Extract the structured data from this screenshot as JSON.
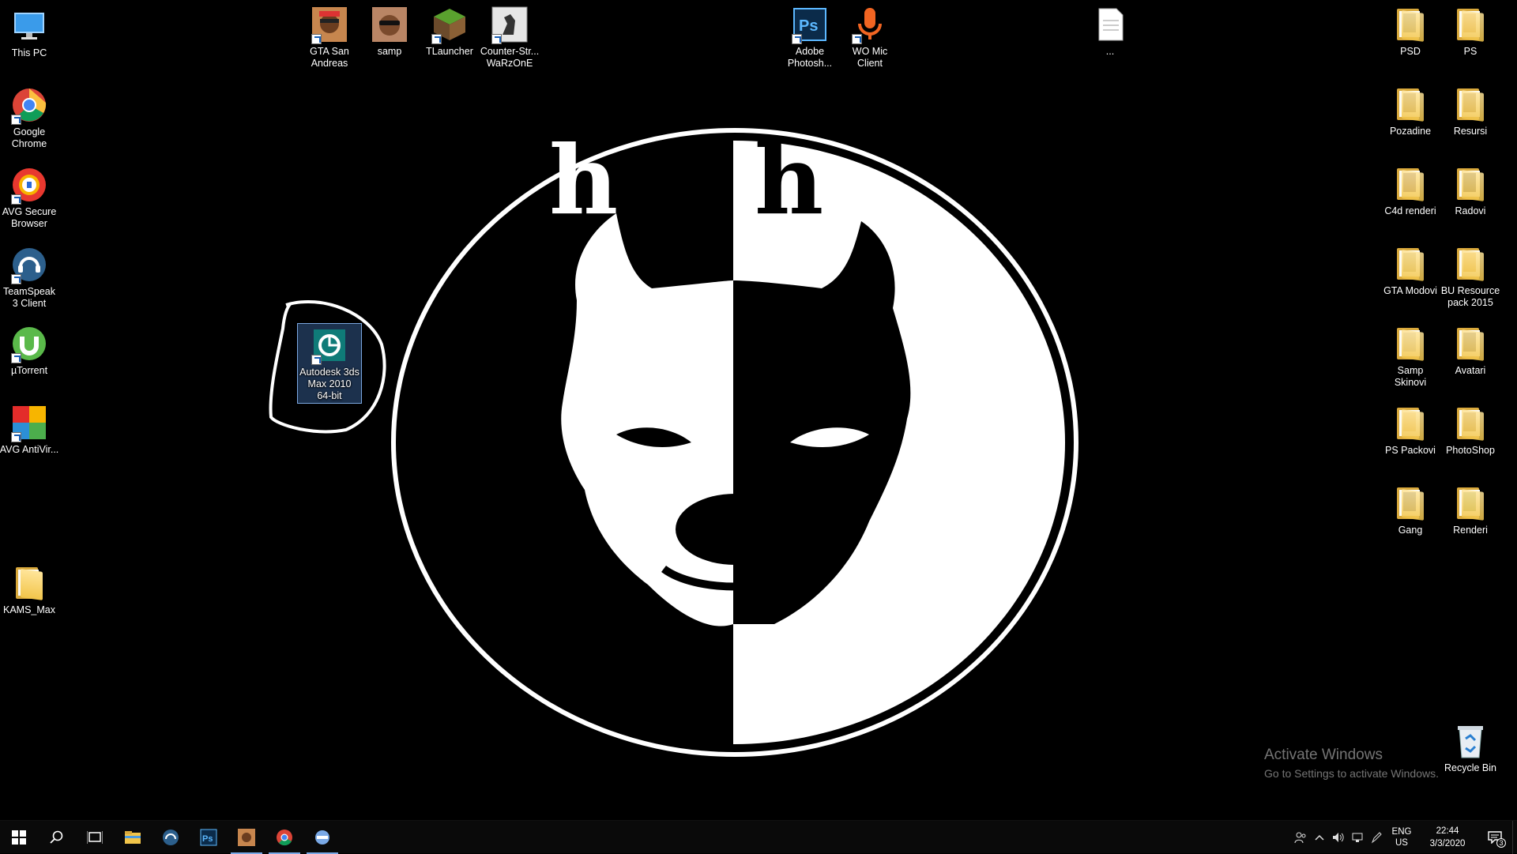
{
  "desktop": {
    "left_column": [
      {
        "label": "This PC",
        "icon": "this-pc-icon"
      },
      {
        "label": "Google Chrome",
        "icon": "chrome-icon"
      },
      {
        "label": "AVG Secure Browser",
        "icon": "avg-secure-browser-icon"
      },
      {
        "label": "TeamSpeak 3 Client",
        "icon": "teamspeak-icon"
      },
      {
        "label": "µTorrent",
        "icon": "utorrent-icon"
      },
      {
        "label": "AVG AntiVir...",
        "icon": "avg-antivirus-icon"
      }
    ],
    "kams_max": {
      "label": "KAMS_Max",
      "icon": "folder-icon"
    },
    "top_row": [
      {
        "label": "GTA San Andreas",
        "icon": "gta-sa-icon"
      },
      {
        "label": "samp",
        "icon": "samp-icon"
      },
      {
        "label": "TLauncher",
        "icon": "tlauncher-icon"
      },
      {
        "label": "Counter-Str... WaRzOnE",
        "icon": "counter-strike-icon"
      },
      {
        "label": "Adobe Photosh...",
        "icon": "photoshop-icon"
      },
      {
        "label": "WO Mic Client",
        "icon": "wo-mic-icon"
      },
      {
        "label": "...",
        "icon": "text-file-icon"
      }
    ],
    "selected_icon": {
      "label": "Autodesk 3ds Max 2010 64-bit",
      "icon": "3ds-max-icon"
    },
    "right_folders": [
      {
        "label": "PSD"
      },
      {
        "label": "PS"
      },
      {
        "label": "Pozadine"
      },
      {
        "label": "Resursi"
      },
      {
        "label": "C4d renderi"
      },
      {
        "label": "Radovi"
      },
      {
        "label": "GTA Modovi"
      },
      {
        "label": "BU Resource pack 2015"
      },
      {
        "label": "Samp Skinovi"
      },
      {
        "label": "Avatari"
      },
      {
        "label": "PS Packovi"
      },
      {
        "label": "PhotoShop"
      },
      {
        "label": "Gang"
      },
      {
        "label": "Renderi"
      }
    ],
    "recycle_bin": {
      "label": "Recycle Bin",
      "icon": "recycle-bin-icon"
    },
    "wallpaper_letters": [
      "h",
      "h"
    ]
  },
  "watermark": {
    "title": "Activate Windows",
    "subtitle": "Go to Settings to activate Windows."
  },
  "taskbar": {
    "lang_top": "ENG",
    "lang_bottom": "US",
    "time": "22:44",
    "date": "3/3/2020",
    "notification_count": "3"
  },
  "colors": {
    "taskbar_bg": "#0a0a0a",
    "active_indicator": "#7aa9e6",
    "folder_yellow": "#f2c54a"
  }
}
